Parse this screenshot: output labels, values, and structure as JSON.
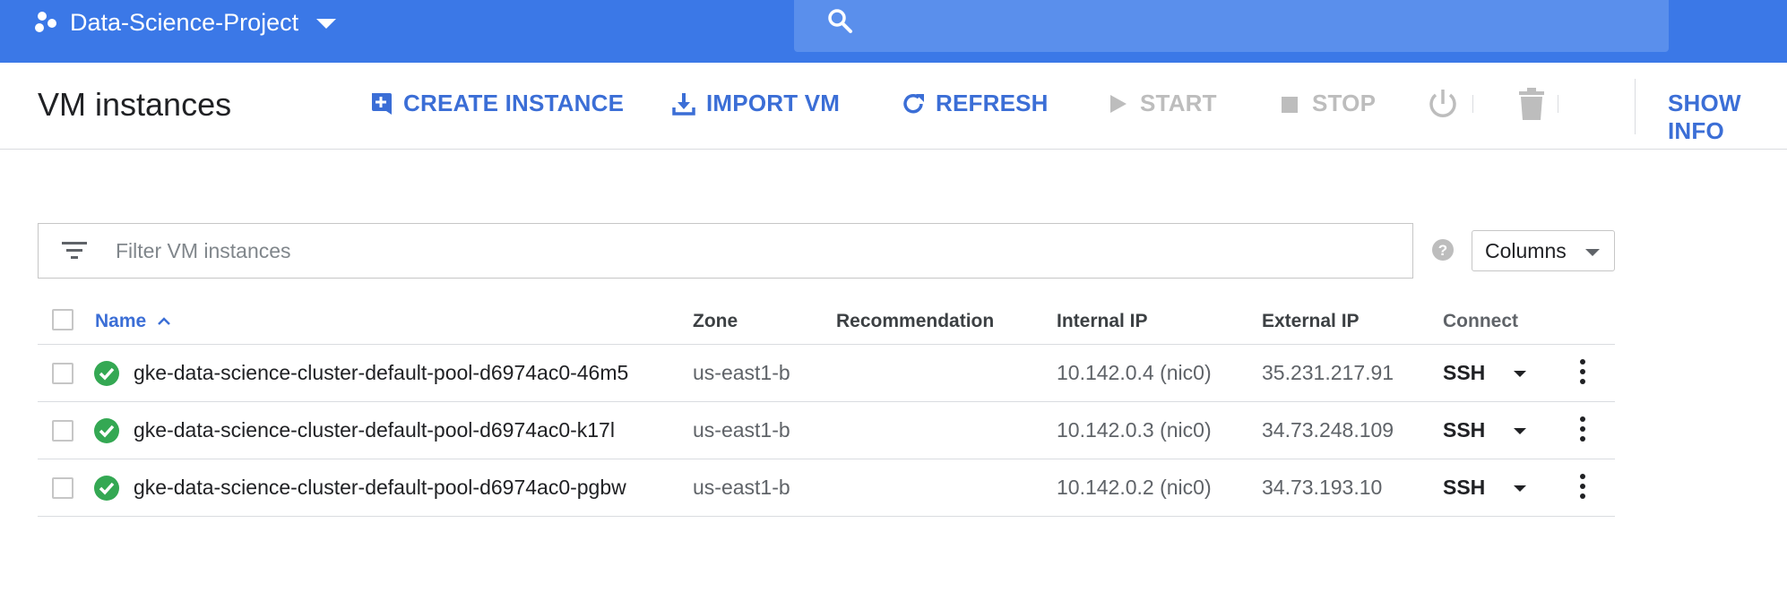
{
  "topbar": {
    "project_name": "Data-Science-Project",
    "accent": "#3b78e7"
  },
  "toolbar": {
    "title": "VM instances",
    "create_label": "CREATE INSTANCE",
    "import_label": "IMPORT VM",
    "refresh_label": "REFRESH",
    "start_label": "START",
    "stop_label": "STOP",
    "show_info_label": "SHOW INFO"
  },
  "filter": {
    "placeholder": "Filter VM instances",
    "columns_label": "Columns"
  },
  "table": {
    "headers": {
      "name": "Name",
      "zone": "Zone",
      "recommendation": "Recommendation",
      "internal_ip": "Internal IP",
      "external_ip": "External IP",
      "connect": "Connect"
    },
    "rows": [
      {
        "status": "running",
        "name": "gke-data-science-cluster-default-pool-d6974ac0-46m5",
        "zone": "us-east1-b",
        "recommendation": "",
        "internal_ip": "10.142.0.4 (nic0)",
        "external_ip": "35.231.217.91",
        "connect": "SSH"
      },
      {
        "status": "running",
        "name": "gke-data-science-cluster-default-pool-d6974ac0-k17l",
        "zone": "us-east1-b",
        "recommendation": "",
        "internal_ip": "10.142.0.3 (nic0)",
        "external_ip": "34.73.248.109",
        "connect": "SSH"
      },
      {
        "status": "running",
        "name": "gke-data-science-cluster-default-pool-d6974ac0-pgbw",
        "zone": "us-east1-b",
        "recommendation": "",
        "internal_ip": "10.142.0.2 (nic0)",
        "external_ip": "34.73.193.10",
        "connect": "SSH"
      }
    ]
  },
  "icons": {
    "project": "project-dots-icon",
    "search": "search-icon",
    "create": "add-box-icon",
    "import": "download-icon",
    "refresh": "refresh-icon",
    "start": "play-icon",
    "stop": "stop-icon",
    "reset": "power-icon",
    "delete": "trash-icon",
    "filter": "filter-icon",
    "help": "help-icon",
    "status_ok": "check-circle-icon",
    "more": "more-vert-icon"
  }
}
